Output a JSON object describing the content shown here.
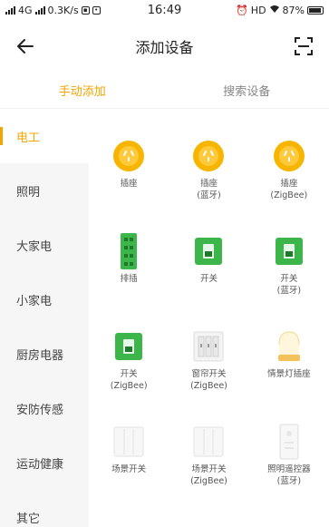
{
  "status_bar": {
    "signal": "4G",
    "speed": "0.3K/s",
    "time": "16:49",
    "hd": "HD",
    "battery": "87%"
  },
  "header": {
    "title": "添加设备"
  },
  "tabs": [
    {
      "label": "手动添加",
      "active": true
    },
    {
      "label": "搜索设备",
      "active": false
    }
  ],
  "sidebar": {
    "items": [
      {
        "label": "电工",
        "active": true
      },
      {
        "label": "照明",
        "active": false
      },
      {
        "label": "大家电",
        "active": false
      },
      {
        "label": "小家电",
        "active": false
      },
      {
        "label": "厨房电器",
        "active": false
      },
      {
        "label": "安防传感",
        "active": false
      },
      {
        "label": "运动健康",
        "active": false
      },
      {
        "label": "其它",
        "active": false
      }
    ]
  },
  "devices": [
    {
      "label": "插座",
      "icon": "socket-icon"
    },
    {
      "label": "插座\n(蓝牙)",
      "icon": "socket-icon"
    },
    {
      "label": "插座\n(ZigBee)",
      "icon": "socket-icon"
    },
    {
      "label": "排插",
      "icon": "power-strip-icon"
    },
    {
      "label": "开关",
      "icon": "switch-icon"
    },
    {
      "label": "开关\n(蓝牙)",
      "icon": "switch-icon"
    },
    {
      "label": "开关\n(ZigBee)",
      "icon": "switch-icon"
    },
    {
      "label": "窗帘开关\n(ZigBee)",
      "icon": "curtain-switch-icon"
    },
    {
      "label": "情景灯插座",
      "icon": "scene-lamp-icon"
    },
    {
      "label": "场景开关",
      "icon": "scene-switch-icon"
    },
    {
      "label": "场景开关\n(ZigBee)",
      "icon": "scene-switch-icon"
    },
    {
      "label": "照明遥控器\n(蓝牙)",
      "icon": "remote-icon"
    }
  ],
  "colors": {
    "accent": "#f5a400",
    "socket": "#f7b500",
    "switch_green": "#3cb54a"
  }
}
